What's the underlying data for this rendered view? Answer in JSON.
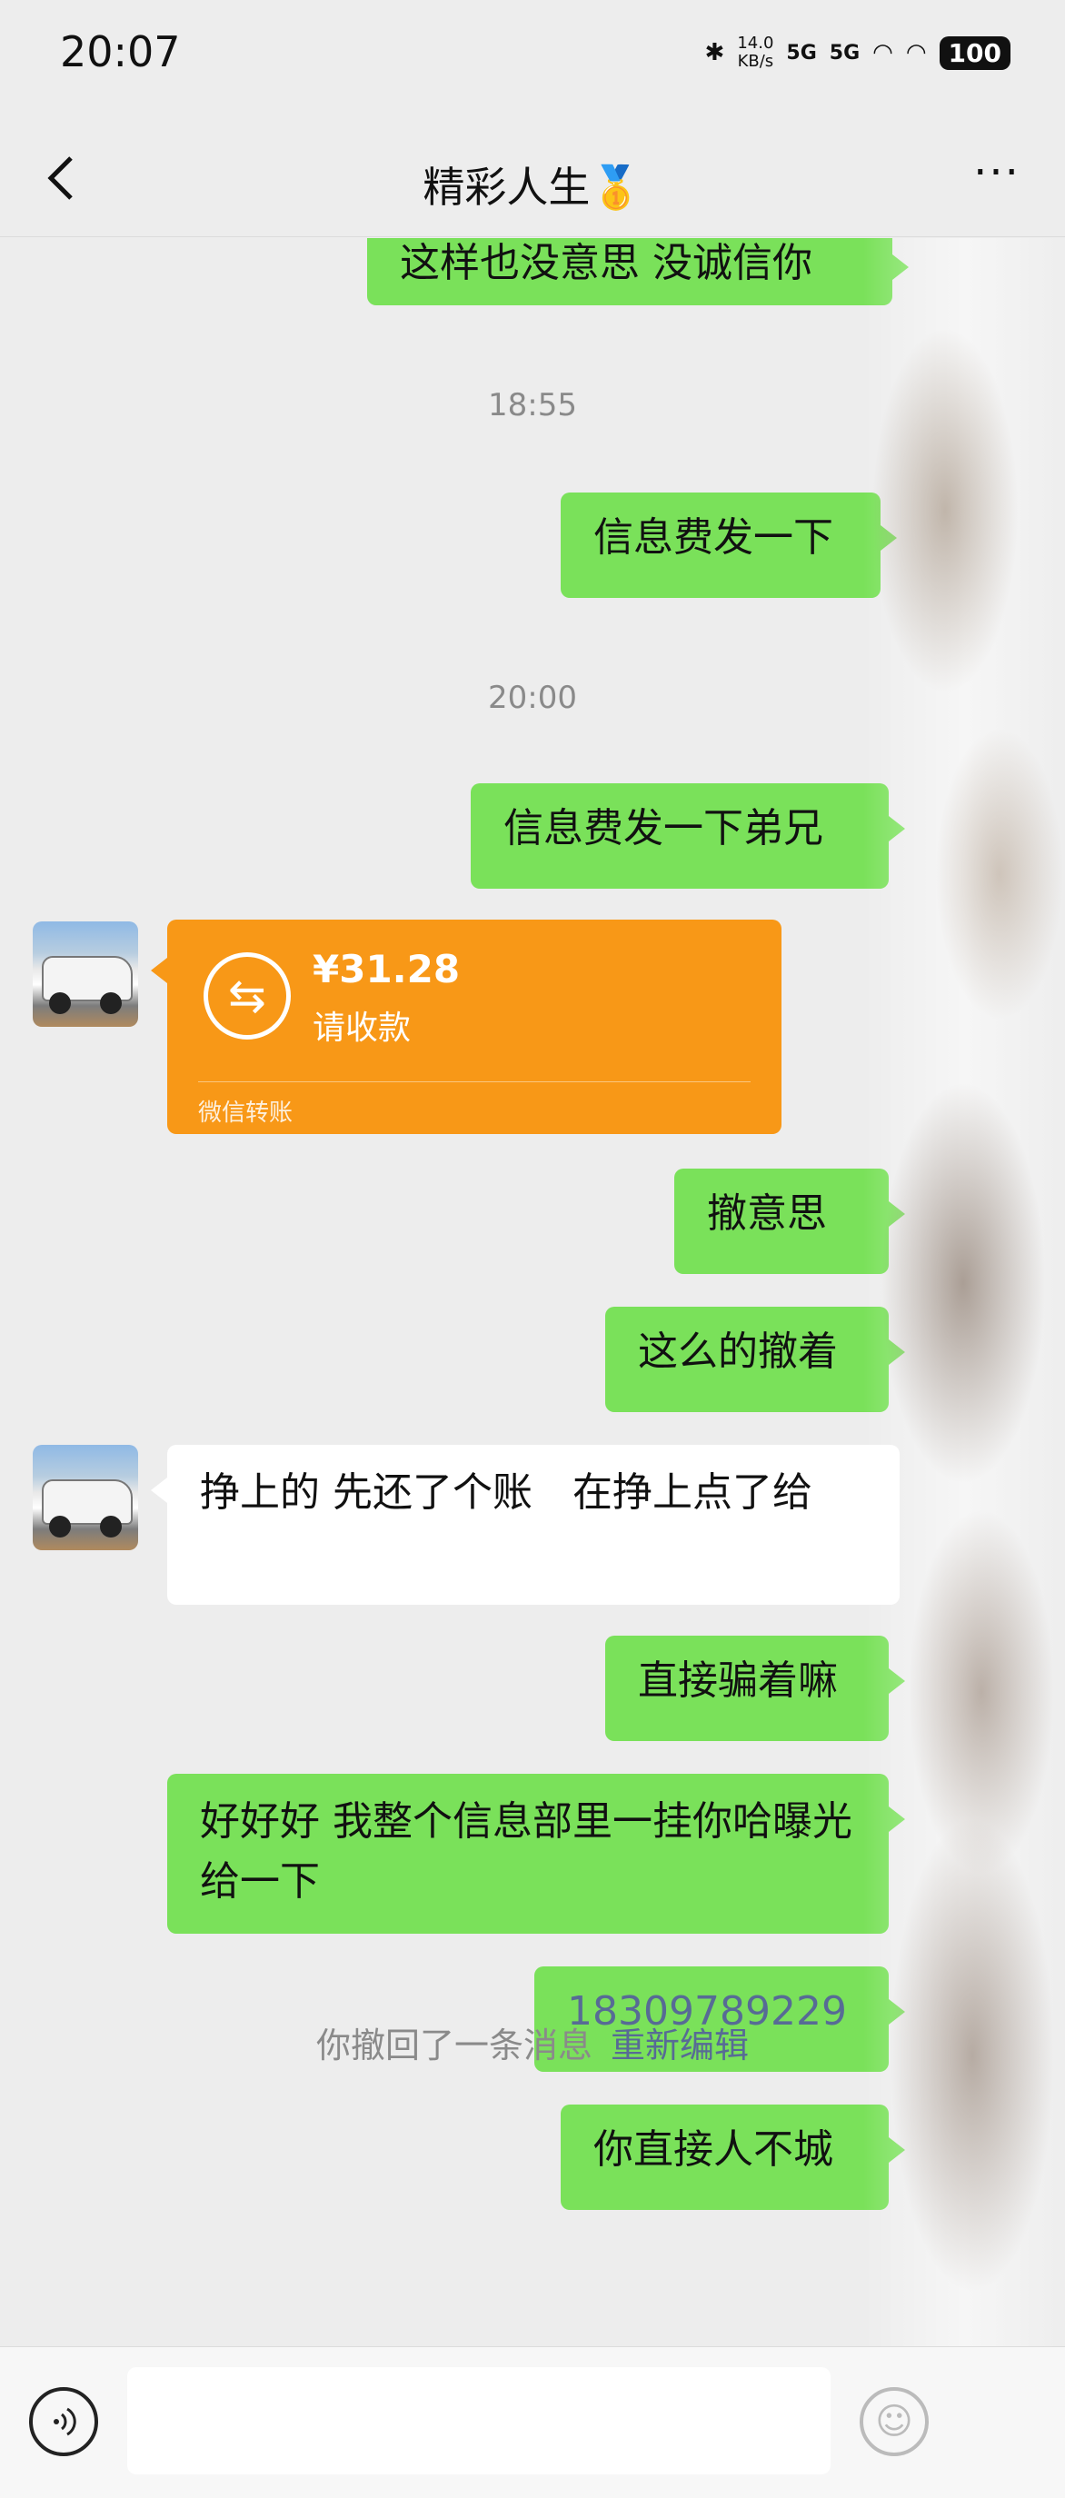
{
  "status_bar": {
    "time": "20:07",
    "bluetooth_icon": "bluetooth-icon",
    "net_speed_value": "14.0",
    "net_speed_unit": "KB/s",
    "signal1": "5G",
    "signal2": "5G",
    "battery": "100"
  },
  "nav": {
    "title": "精彩人生🥇",
    "back_icon": "chevron-left-icon",
    "more_icon": "more-icon"
  },
  "messages": {
    "m1": "这样也没意思 没诚信你",
    "ts1": "18:55",
    "m2": "信息费发一下",
    "ts2": "20:00",
    "m3": "信息费发一下弟兄",
    "transfer": {
      "amount": "¥31.28",
      "status": "请收款",
      "footer": "微信转账"
    },
    "m4": "撤意思",
    "m5": "这么的撤着",
    "m6": "挣上的 先还了个账　在挣上点了给",
    "m7": "直接骗着嘛",
    "m8": "好好好 我整个信息部里一挂你哈曝光给一下",
    "m9": "18309789229",
    "m10": "你直接人不城"
  },
  "recall": {
    "text": "你撤回了一条消息",
    "edit": "重新编辑"
  },
  "input": {
    "voice_icon": "voice-icon",
    "emoji_icon": "emoji-icon",
    "value": ""
  },
  "colors": {
    "out_bubble": "#7ae15a",
    "in_bubble": "#ffffff",
    "transfer": "#f89817",
    "link": "#576b95",
    "background": "#ededed"
  }
}
